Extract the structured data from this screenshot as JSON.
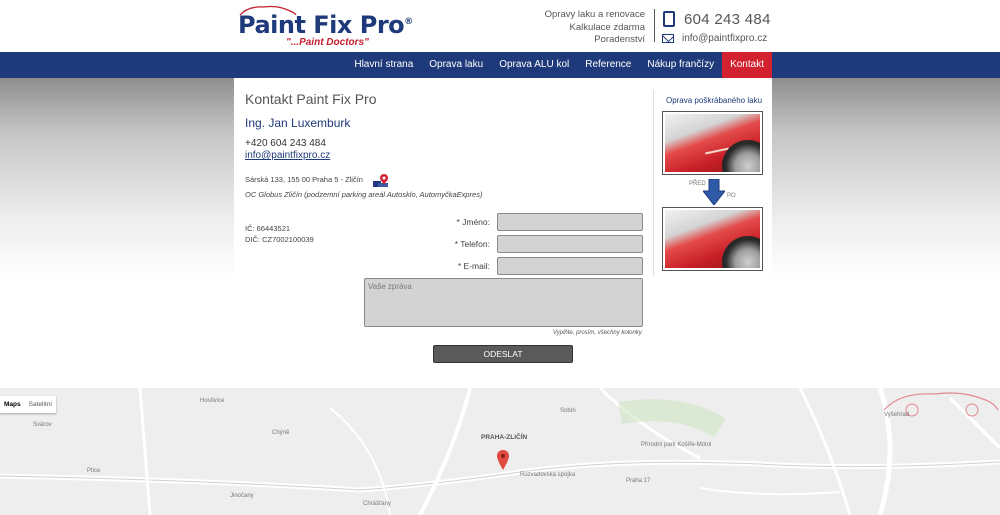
{
  "header": {
    "logo": {
      "main": "Paint Fix Pro",
      "reg": "®",
      "tagline": "\"...Paint Doctors\""
    },
    "services": [
      "Opravy laku a renovace",
      "Kalkulace zdarma",
      "Poradenství"
    ],
    "phone": "604 243 484",
    "email": "info@paintfixpro.cz"
  },
  "nav": {
    "items": [
      {
        "label": "Hlavní strana"
      },
      {
        "label": "Oprava laku"
      },
      {
        "label": "Oprava ALU kol"
      },
      {
        "label": "Reference"
      },
      {
        "label": "Nákup frančízy"
      },
      {
        "label": "Kontakt"
      }
    ],
    "active": "Kontakt"
  },
  "content": {
    "title": "Kontakt Paint Fix Pro",
    "person": "Ing. Jan Luxemburk",
    "phone": "+420 604 243 484",
    "email": "info@paintfixpro.cz",
    "address": "Sárská 133, 155 00 Praha 5 - Zličín",
    "location_note": "OC Globus Zličín (podzemní parking areál Autosklo, AutomyčkaExpres)",
    "ico": "IČ: 66443521",
    "dic": "DIČ: CZ7002100039"
  },
  "form": {
    "name_label": "* Jméno:",
    "phone_label": "* Telefon:",
    "email_label": "* E-mail:",
    "name_value": "",
    "phone_value": "",
    "email_value": "",
    "message_placeholder": "Vaše zpráva",
    "hint": "Vyplňte, prosím, všechny kolonky.",
    "submit_label": "ODESLAT"
  },
  "sidebar": {
    "title": "Oprava poškrábaného laku",
    "before_label": "PŘED",
    "after_label": "PO"
  },
  "map": {
    "buttons": [
      "Maps",
      "Satelitní"
    ],
    "active_button": "Maps",
    "places": [
      "Svárov",
      "Chýně",
      "Ptice",
      "Chrášťany",
      "PRAHA-ZLIČÍN",
      "Přírodní park Košíře-Motol",
      "Rozvadovská spojka",
      "Praha 17",
      "Vyšehrad",
      "Hostivice",
      "Sobín",
      "Jinočany"
    ]
  },
  "colors": {
    "brand_blue": "#1f3a7a",
    "active_red": "#d3222f",
    "input_gray": "#d3d3d3"
  }
}
